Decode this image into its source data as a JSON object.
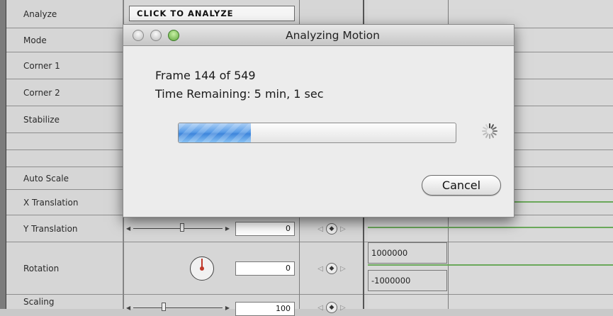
{
  "inspector": {
    "rows": [
      {
        "label": "Analyze"
      },
      {
        "label": "Mode"
      },
      {
        "label": "Corner 1"
      },
      {
        "label": "Corner 2"
      },
      {
        "label": "Stabilize"
      },
      {
        "label": ""
      },
      {
        "label": ""
      },
      {
        "label": "Auto Scale"
      },
      {
        "label": "X Translation"
      },
      {
        "label": "Y Translation"
      },
      {
        "label": "Rotation"
      },
      {
        "label": "Scaling"
      }
    ],
    "analyze_button_label": "CLICK TO ANALYZE",
    "y_translation_value": "0",
    "rotation_value": "0",
    "scaling_value": "100",
    "graph_max": "1000000",
    "graph_min": "-1000000"
  },
  "dialog": {
    "title": "Analyzing Motion",
    "frame_text": "Frame 144 of 549",
    "time_text": "Time Remaining: 5 min, 1 sec",
    "progress": 0.26,
    "cancel_label": "Cancel"
  },
  "colors": {
    "accent": "#5b9ee8",
    "graph_line": "#6aa85a"
  }
}
